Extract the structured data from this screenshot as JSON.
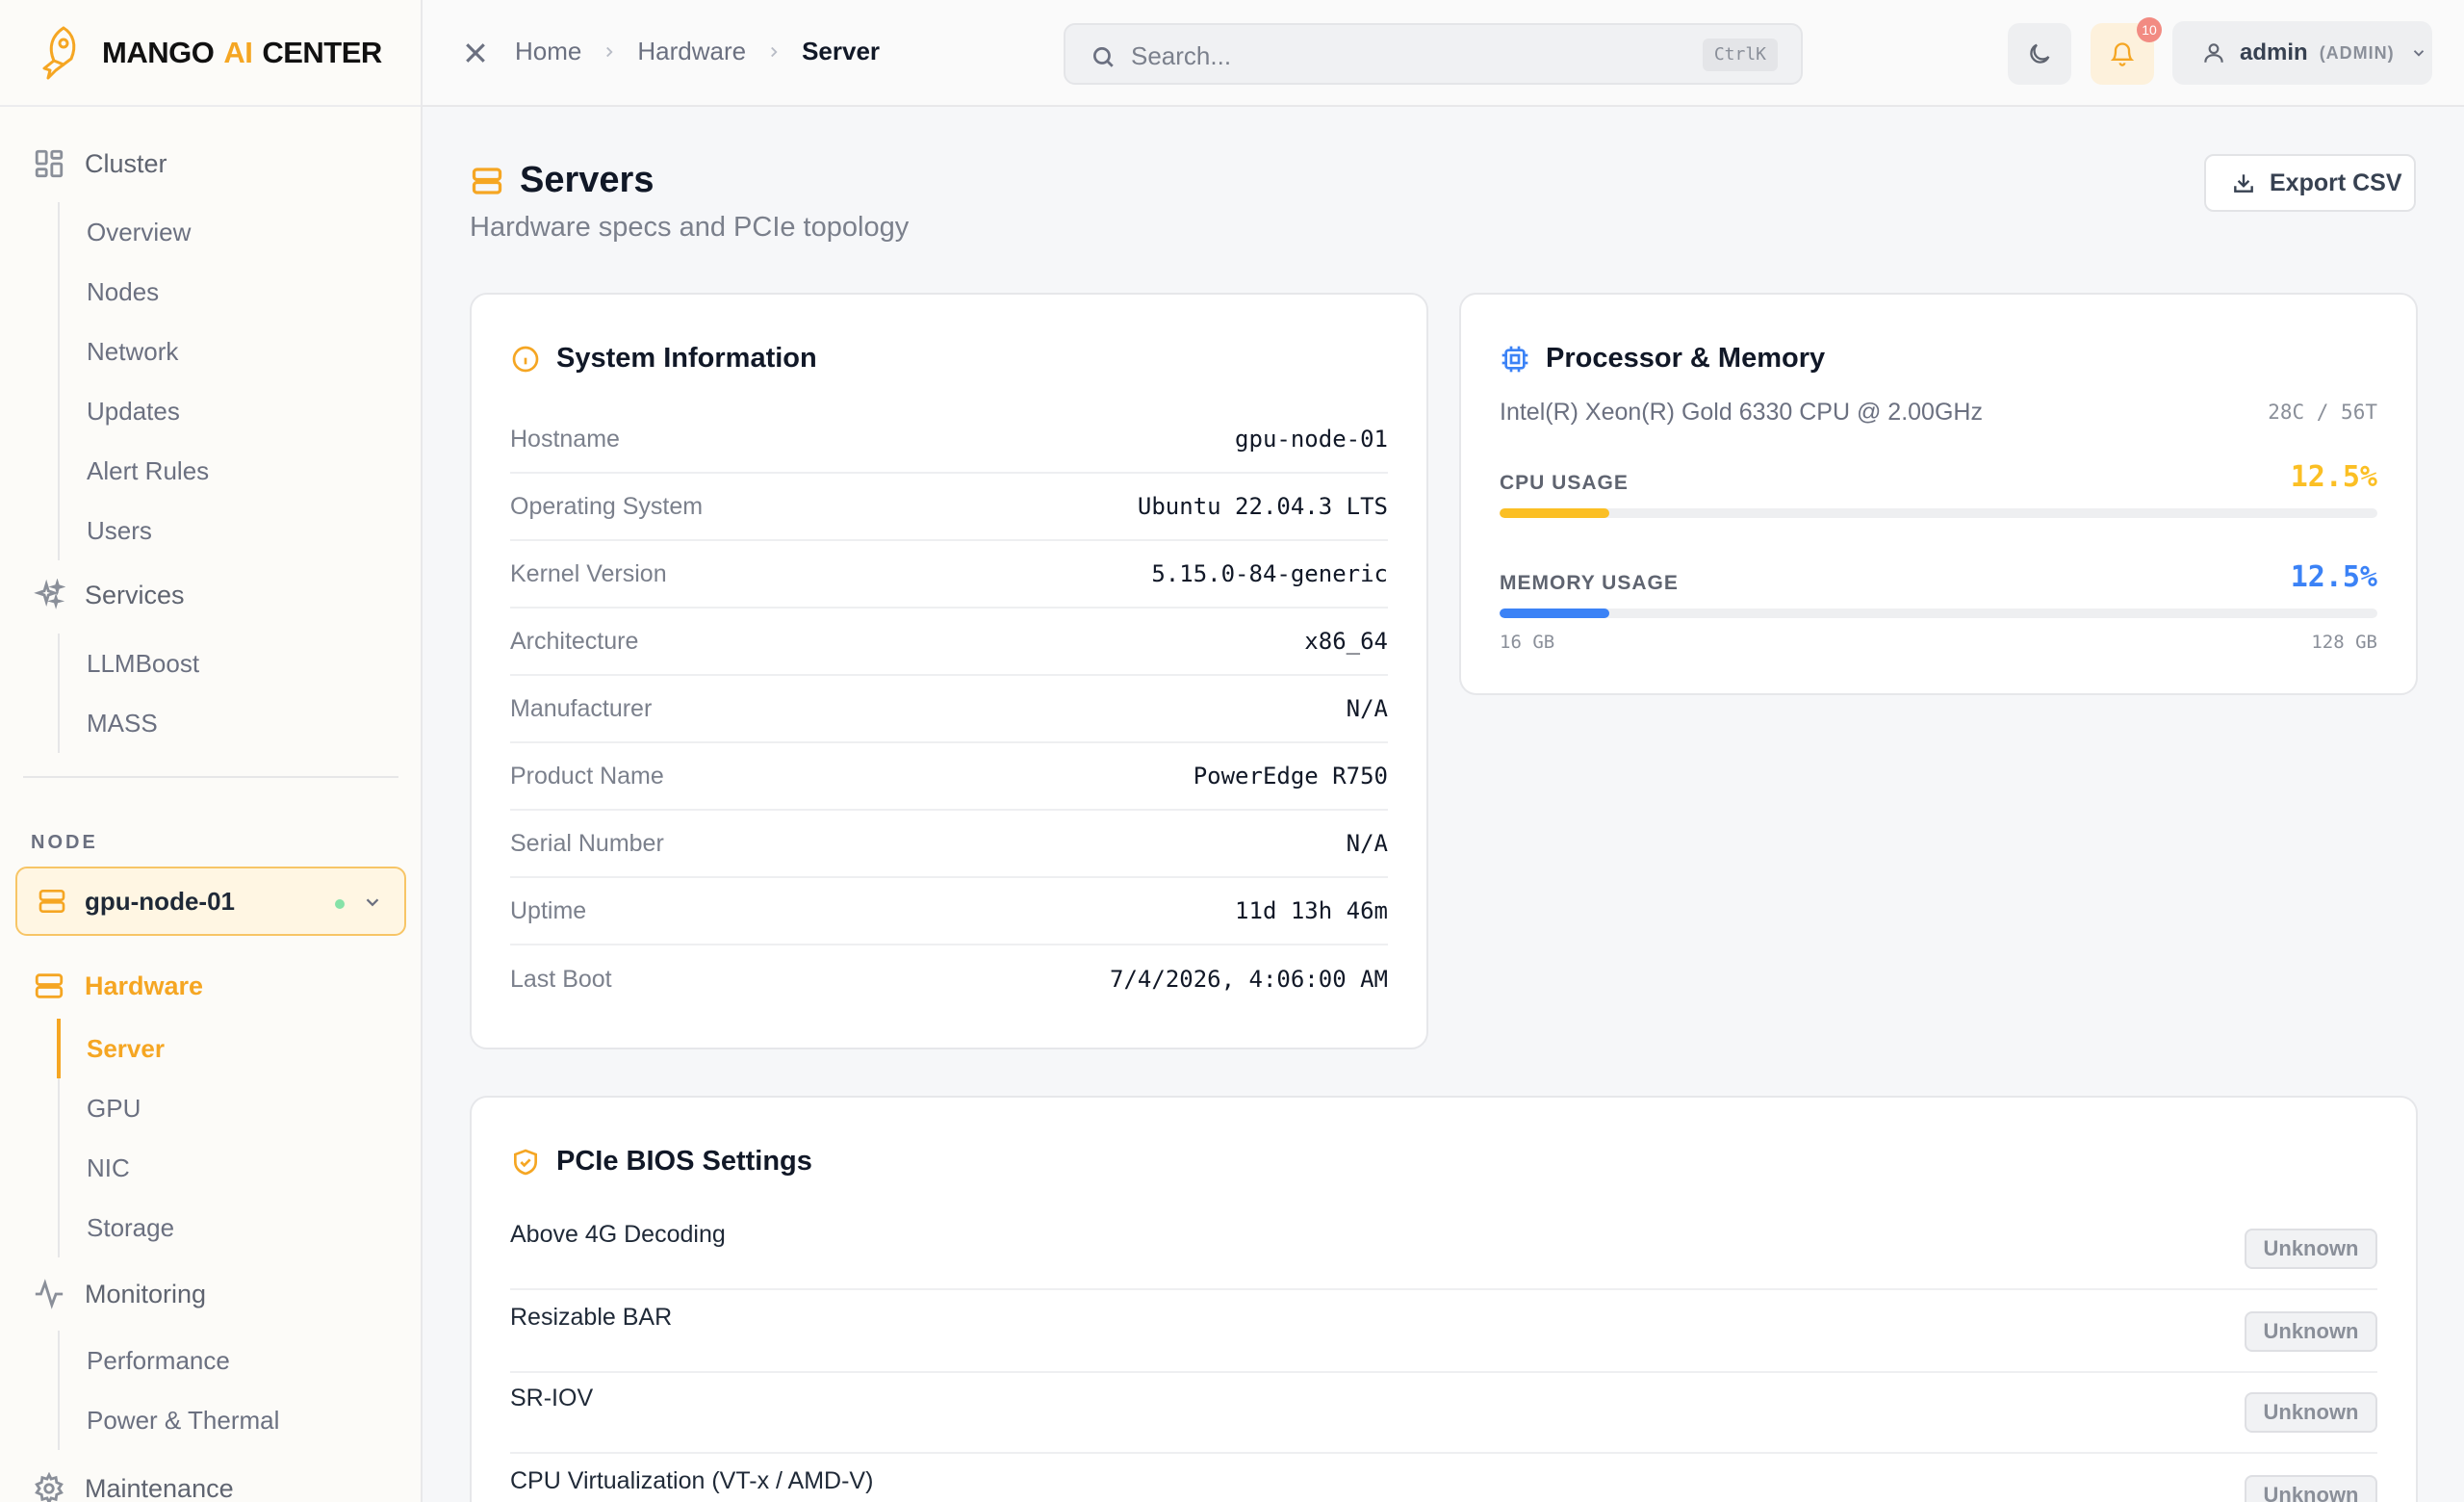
{
  "brand": {
    "part1": "MANGO",
    "part2": "AI",
    "part3": "CENTER"
  },
  "sidebar": {
    "cluster": {
      "label": "Cluster",
      "items": [
        "Overview",
        "Nodes",
        "Network",
        "Updates",
        "Alert Rules",
        "Users"
      ]
    },
    "services": {
      "label": "Services",
      "items": [
        "LLMBoost",
        "MASS"
      ]
    },
    "node_label": "NODE",
    "node_name": "gpu-node-01",
    "hardware": {
      "label": "Hardware",
      "items": [
        "Server",
        "GPU",
        "NIC",
        "Storage"
      ],
      "active": "Server"
    },
    "monitoring": {
      "label": "Monitoring",
      "items": [
        "Performance",
        "Power & Thermal"
      ]
    },
    "maintenance": {
      "label": "Maintenance"
    }
  },
  "topbar": {
    "breadcrumb": [
      "Home",
      "Hardware",
      "Server"
    ],
    "search_placeholder": "Search...",
    "search_shortcut": "CtrlK",
    "notifications_count": "10",
    "user_name": "admin",
    "user_role": "(ADMIN)"
  },
  "page": {
    "title": "Servers",
    "subtitle": "Hardware specs and PCIe topology",
    "export_label": "Export CSV"
  },
  "system_info": {
    "title": "System Information",
    "rows": [
      {
        "key": "Hostname",
        "value": "gpu-node-01"
      },
      {
        "key": "Operating System",
        "value": "Ubuntu 22.04.3 LTS"
      },
      {
        "key": "Kernel Version",
        "value": "5.15.0-84-generic"
      },
      {
        "key": "Architecture",
        "value": "x86_64"
      },
      {
        "key": "Manufacturer",
        "value": "N/A"
      },
      {
        "key": "Product Name",
        "value": "PowerEdge R750"
      },
      {
        "key": "Serial Number",
        "value": "N/A"
      },
      {
        "key": "Uptime",
        "value": "11d 13h 46m"
      },
      {
        "key": "Last Boot",
        "value": "7/4/2026, 4:06:00 AM"
      }
    ]
  },
  "processor": {
    "title": "Processor & Memory",
    "cpu_model": "Intel(R) Xeon(R) Gold 6330 CPU @ 2.00GHz",
    "cores": "28C / 56T",
    "cpu_usage_label": "CPU USAGE",
    "cpu_usage": "12.5%",
    "cpu_usage_fraction": 0.125,
    "memory_usage_label": "MEMORY USAGE",
    "memory_usage": "12.5%",
    "memory_usage_fraction": 0.125,
    "memory_used": "16 GB",
    "memory_total": "128 GB"
  },
  "bios": {
    "title": "PCIe BIOS Settings",
    "rows": [
      {
        "key": "Above 4G Decoding",
        "status": "Unknown"
      },
      {
        "key": "Resizable BAR",
        "status": "Unknown"
      },
      {
        "key": "SR-IOV",
        "status": "Unknown"
      },
      {
        "key": "CPU Virtualization (VT-x / AMD-V)",
        "status": "Unknown"
      }
    ]
  },
  "colors": {
    "accent": "#f5a623",
    "cpu_bar": "#fbbf24",
    "mem_bar": "#3b82f6",
    "status_online": "#86e2a8"
  }
}
